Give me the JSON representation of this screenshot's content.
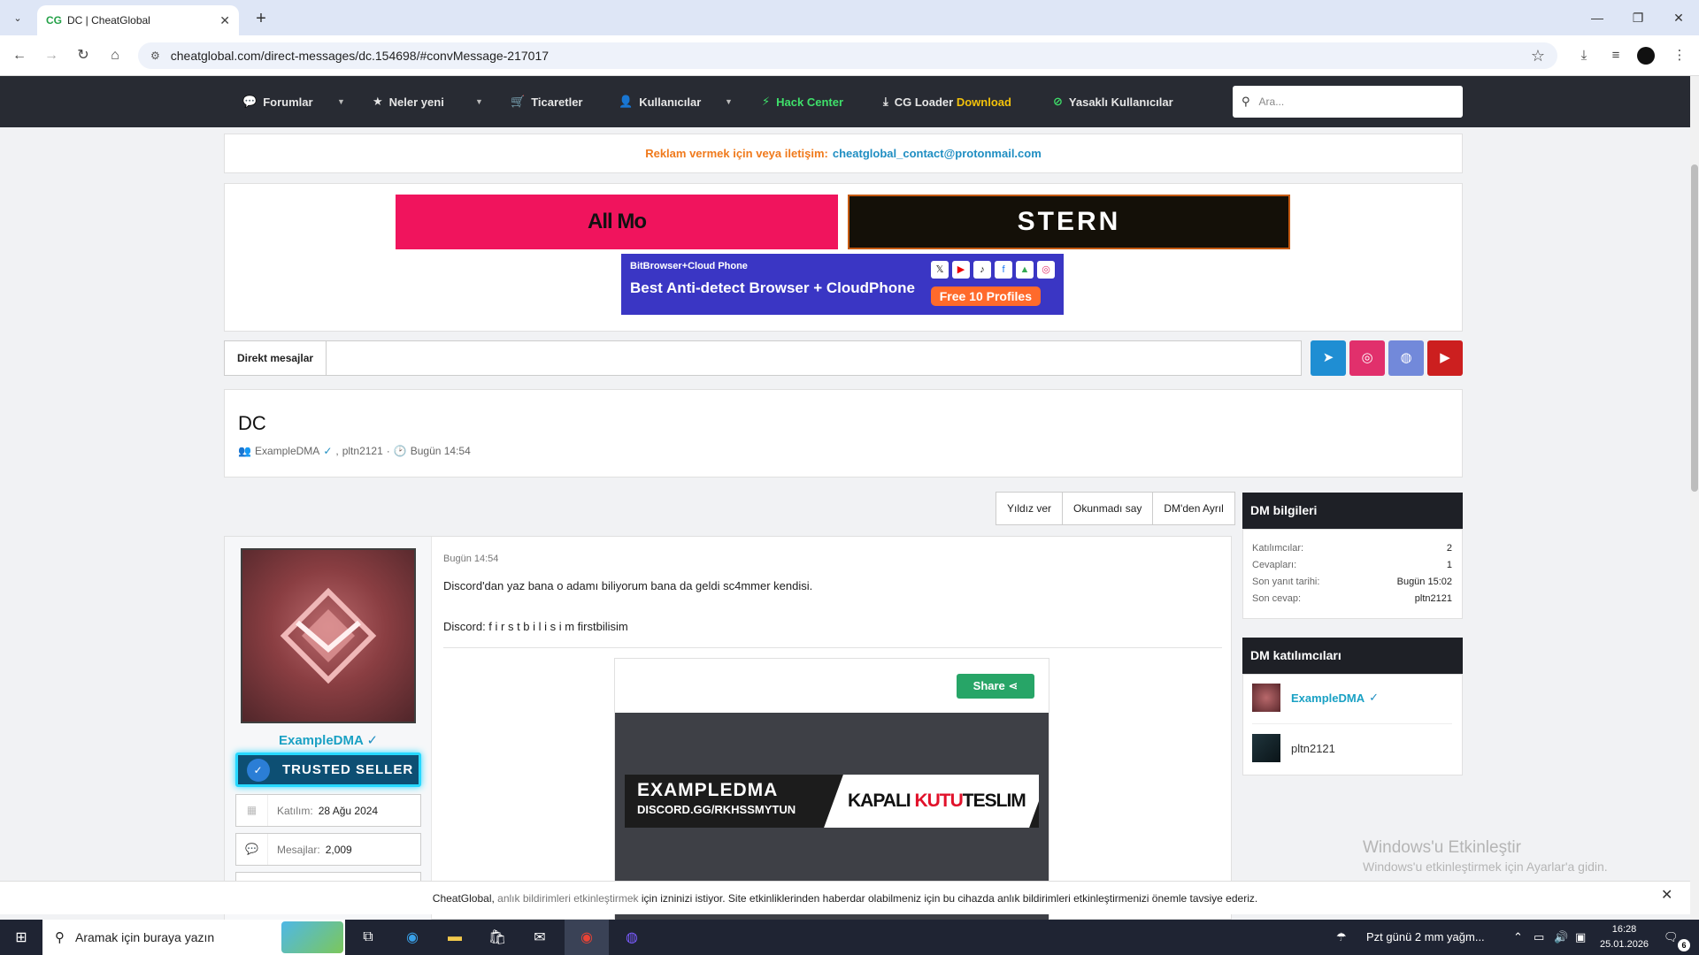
{
  "browser": {
    "tab_title": "DC | CheatGlobal",
    "tab_favicon": "CG",
    "url": "cheatglobal.com/direct-messages/dc.154698/#convMessage-217017"
  },
  "nav": {
    "items": [
      "Forumlar",
      "Neler yeni",
      "Ticaretler",
      "Kullanıcılar",
      "Hack Center",
      "CG Loader",
      "Download",
      "Yasaklı Kullanıcılar"
    ],
    "search_placeholder": "Ara..."
  },
  "ad": {
    "label": "Reklam vermek için veya iletişim:",
    "email": "cheatglobal_contact@protonmail.com"
  },
  "banners": {
    "b1": "All Mo",
    "b2": "STERN",
    "b3_brand": "BitBrowser+Cloud Phone",
    "b3_title": "Best Anti-detect Browser + CloudPhone",
    "b3_cta": "Free 10 Profiles"
  },
  "breadcrumb": "Direkt mesajlar",
  "conversation": {
    "title": "DC",
    "participants_meta": "ExampleDMA",
    "participant2": "pltn2121",
    "time": "Bugün 14:54"
  },
  "actions": [
    "Yıldız ver",
    "Okunmadı say",
    "DM'den Ayrıl"
  ],
  "post": {
    "author": "ExampleDMA",
    "badge": "TRUSTED SELLER",
    "joined_label": "Katılım:",
    "joined_value": "28 Ağu 2024",
    "messages_label": "Mesajlar:",
    "messages_value": "2,009",
    "time": "Bugün 14:54",
    "line1": "Discord'dan yaz bana o adamı biliyorum bana da geldi sc4mmer kendisi.",
    "line2": "Discord: f i r s t b i l i s i m firstbilisim",
    "share": "Share",
    "embed_name": "EXAMPLEDMA",
    "embed_discord": "DISCORD.GG/RKHSSMYTUN",
    "embed_tag1": "KAPALI",
    "embed_tag2": "KUTU",
    "embed_tag3": "TESLIM"
  },
  "sidebar": {
    "info_title": "DM bilgileri",
    "info": [
      {
        "k": "Katılımcılar:",
        "v": "2"
      },
      {
        "k": "Cevapları:",
        "v": "1"
      },
      {
        "k": "Son yanıt tarihi:",
        "v": "Bugün 15:02"
      },
      {
        "k": "Son cevap:",
        "v": "pltn2121"
      }
    ],
    "participants_title": "DM katılımcıları",
    "participants": [
      "ExampleDMA",
      "pltn2121"
    ]
  },
  "watermark": {
    "line1": "Windows'u Etkinleştir",
    "line2": "Windows'u etkinleştirmek için Ayarlar'a gidin."
  },
  "notification": {
    "site": "CheatGlobal,",
    "link": "anlık bildirimleri etkinleştirmek",
    "text": "için izninizi istiyor. Site etkinliklerinden haberdar olabilmeniz için bu cihazda anlık bildirimleri etkinleştirmenizi önemle tavsiye ederiz."
  },
  "taskbar": {
    "search_placeholder": "Aramak için buraya yazın",
    "weather": "Pzt günü 2 mm yağm...",
    "time": "16:28",
    "date": "25.01.2026",
    "notif_count": "6"
  },
  "colors": {
    "nav_bg": "#282b33",
    "accent_green": "#27a567",
    "accent_cyan": "#1aa1c4",
    "ad_orange": "#f07a1c",
    "telegram": "#1f8ed3",
    "instagram": "#e1306c",
    "discord": "#7289da",
    "youtube": "#cc1f1f"
  }
}
